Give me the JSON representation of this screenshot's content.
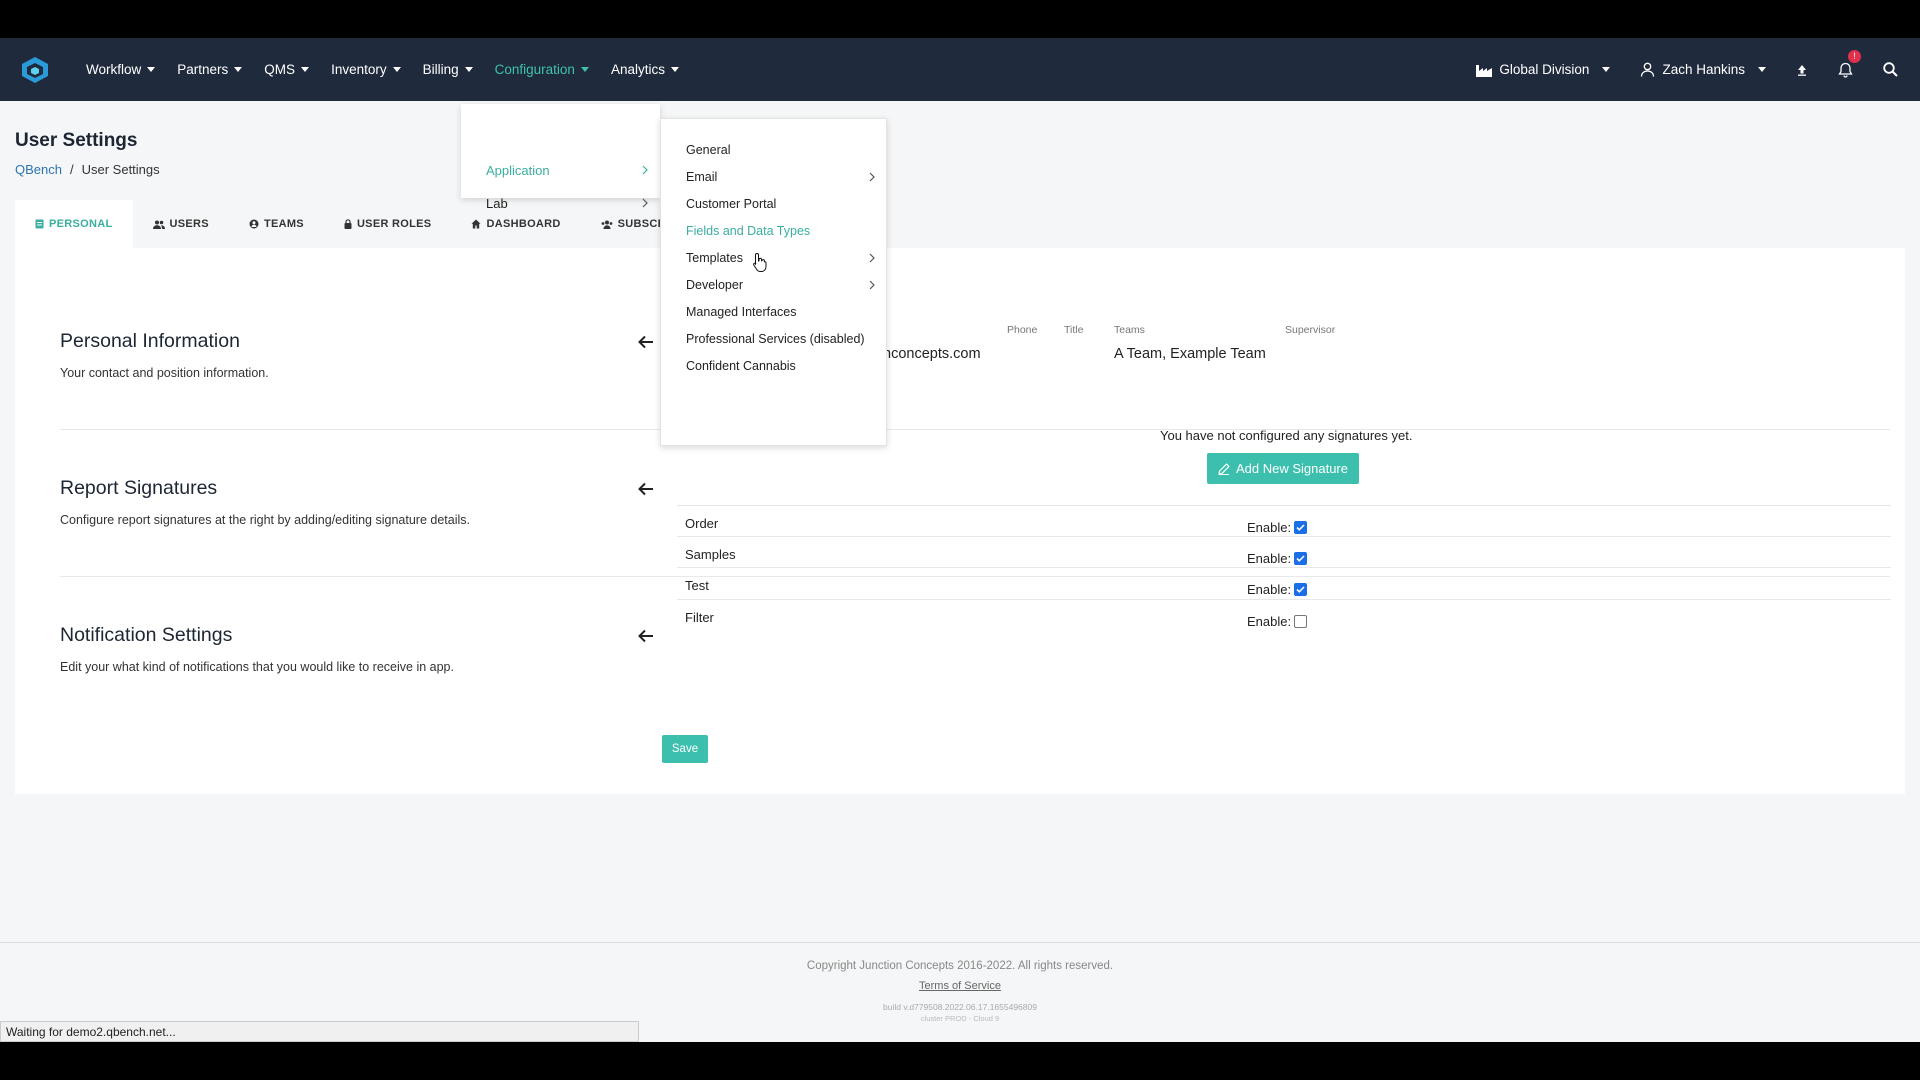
{
  "nav": {
    "items": [
      {
        "label": "Workflow"
      },
      {
        "label": "Partners"
      },
      {
        "label": "QMS"
      },
      {
        "label": "Inventory"
      },
      {
        "label": "Billing"
      },
      {
        "label": "Configuration",
        "active": true
      },
      {
        "label": "Analytics"
      }
    ],
    "division": "Global Division",
    "user": "Zach Hankins",
    "notification_badge": "!"
  },
  "page": {
    "title": "User Settings",
    "breadcrumb": {
      "root": "QBench",
      "separator": "/",
      "current": "User Settings"
    }
  },
  "tabs": [
    {
      "label": "PERSONAL",
      "active": true
    },
    {
      "label": "USERS"
    },
    {
      "label": "TEAMS"
    },
    {
      "label": "USER ROLES"
    },
    {
      "label": "DASHBOARD"
    },
    {
      "label": "SUBSCRIP"
    }
  ],
  "personal": {
    "title": "Personal Information",
    "desc": "Your contact and position information.",
    "email_partial": "nconcepts.com",
    "labels": {
      "phone": "Phone",
      "title": "Title",
      "teams": "Teams",
      "supervisor": "Supervisor"
    },
    "teams_value": "A Team, Example Team"
  },
  "signatures": {
    "title": "Report Signatures",
    "desc": "Configure report signatures at the right by adding/editing signature details.",
    "empty": "You have not configured any signatures yet.",
    "add_label": "Add New Signature"
  },
  "notifications": {
    "title": "Notification Settings",
    "desc": "Edit your what kind of notifications that you would like to receive in app.",
    "enable_label": "Enable:",
    "rows": [
      {
        "label": "Order",
        "checked": true
      },
      {
        "label": "Samples",
        "checked": true
      },
      {
        "label": "Test",
        "checked": true
      },
      {
        "label": "Filter",
        "checked": false
      }
    ],
    "save_label": "Save"
  },
  "menu": {
    "level1": [
      {
        "label": "Application",
        "active": true,
        "submenu": true
      },
      {
        "label": "Lab",
        "submenu": true
      }
    ],
    "level2": [
      {
        "label": "General",
        "submenu": false
      },
      {
        "label": "Email",
        "submenu": true
      },
      {
        "label": "Customer Portal",
        "submenu": false
      },
      {
        "label": "Fields and Data Types",
        "submenu": false,
        "active": true
      },
      {
        "label": "Templates",
        "submenu": true
      },
      {
        "label": "Developer",
        "submenu": true
      },
      {
        "label": "Managed Interfaces",
        "submenu": false
      },
      {
        "label": "Professional Services (disabled)",
        "submenu": false
      },
      {
        "label": "Confident Cannabis",
        "submenu": false
      }
    ]
  },
  "footer": {
    "copyright": "Copyright Junction Concepts 2016-2022. All rights reserved.",
    "tos": "Terms of Service",
    "build": "build v.d779508.2022.06.17.1655496809",
    "cluster": "cluster PROD - Cloud 9"
  },
  "status_bar": "Waiting for demo2.qbench.net...",
  "colors": {
    "nav_bg": "#1f2a3c",
    "accent": "#3cc0ad",
    "link": "#2b74b3",
    "checkbox": "#1a6ee6"
  }
}
